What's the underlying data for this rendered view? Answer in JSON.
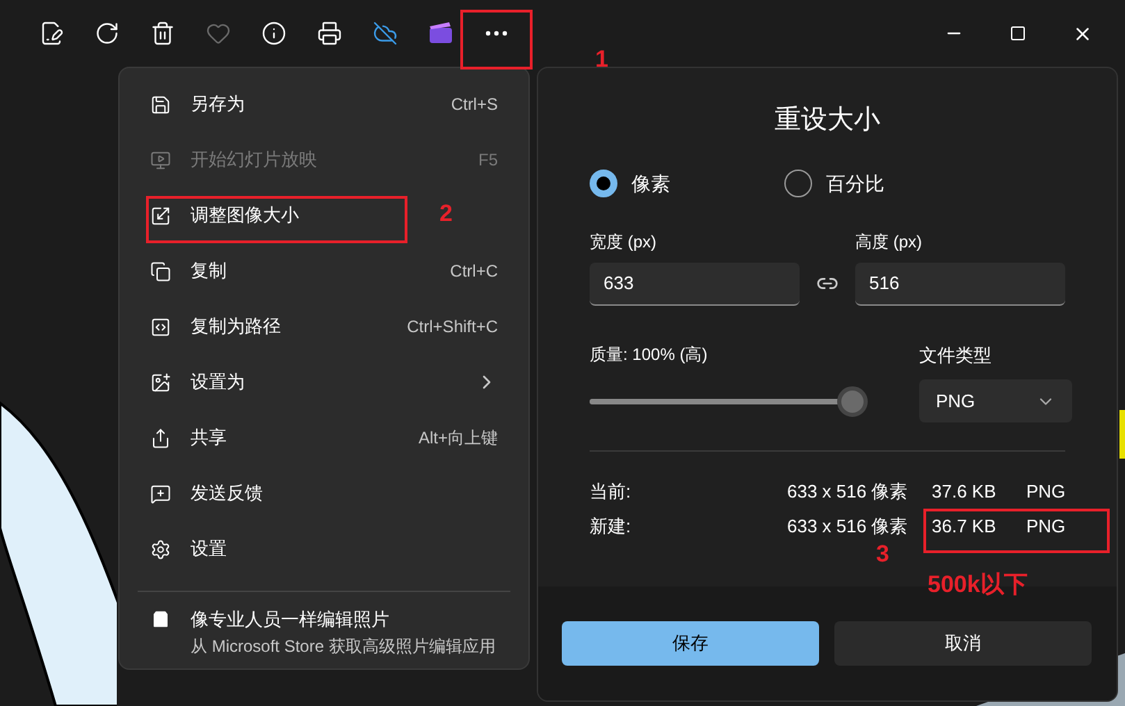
{
  "toolbar": {
    "buttons": [
      {
        "kind": "edit",
        "disabled": false
      },
      {
        "kind": "rotate",
        "disabled": false
      },
      {
        "kind": "delete",
        "disabled": false
      },
      {
        "kind": "favorite",
        "disabled": true
      },
      {
        "kind": "info",
        "disabled": false
      },
      {
        "kind": "print",
        "disabled": false
      },
      {
        "kind": "cloud",
        "disabled": false
      },
      {
        "kind": "video",
        "disabled": false
      },
      {
        "kind": "more",
        "disabled": false
      }
    ]
  },
  "menu": {
    "items": [
      {
        "kind": "save",
        "label": "另存为",
        "shortcut": "Ctrl+S",
        "disabled": false,
        "submenu": false
      },
      {
        "kind": "slideshow",
        "label": "开始幻灯片放映",
        "shortcut": "F5",
        "disabled": true,
        "submenu": false
      },
      {
        "kind": "resize",
        "label": "调整图像大小",
        "disabled": false,
        "submenu": false
      },
      {
        "kind": "copy",
        "label": "复制",
        "shortcut": "Ctrl+C",
        "disabled": false,
        "submenu": false
      },
      {
        "kind": "path",
        "label": "复制为路径",
        "shortcut": "Ctrl+Shift+C",
        "disabled": false,
        "submenu": false
      },
      {
        "kind": "set",
        "label": "设置为",
        "disabled": false,
        "submenu": true
      },
      {
        "kind": "share",
        "label": "共享",
        "shortcut": "Alt+向上键",
        "disabled": false,
        "submenu": false
      },
      {
        "kind": "feedback",
        "label": "发送反馈",
        "disabled": false,
        "submenu": false
      },
      {
        "kind": "settings",
        "label": "设置",
        "disabled": false,
        "submenu": false
      }
    ],
    "promo": {
      "title": "像专业人员一样编辑照片",
      "subtitle": "从 Microsoft Store 获取高级照片编辑应用"
    }
  },
  "dialog": {
    "title": "重设大小",
    "units": [
      {
        "label": "像素",
        "selected": true
      },
      {
        "label": "百分比",
        "selected": false
      }
    ],
    "width": {
      "label": "宽度 (px)",
      "value": "633"
    },
    "height": {
      "label": "高度 (px)",
      "value": "516"
    },
    "quality": {
      "label": "质量: 100% (高)",
      "level": 1
    },
    "file_type": {
      "label": "文件类型",
      "value": "PNG"
    },
    "info": [
      {
        "label": "当前:",
        "dimensions": "633 x 516 像素",
        "size": "37.6 KB",
        "format": "PNG"
      },
      {
        "label": "新建:",
        "dimensions": "633 x 516 像素",
        "size": "36.7 KB",
        "format": "PNG"
      }
    ],
    "save": "保存",
    "cancel": "取消"
  },
  "annotations": {
    "numbers": [
      "1",
      "2",
      "3"
    ],
    "note": "500k以下"
  }
}
